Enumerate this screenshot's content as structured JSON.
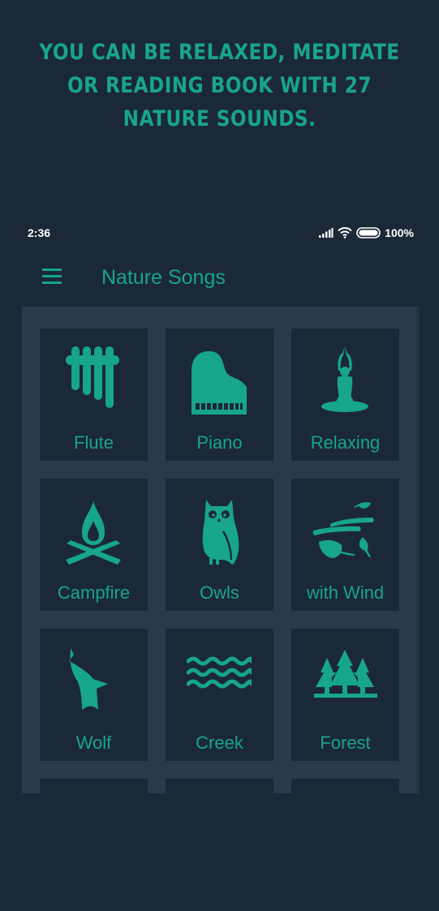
{
  "promo": {
    "lines": [
      "You can be relaxed, meditate",
      "or reading book with 27",
      "nature sounds."
    ]
  },
  "status_bar": {
    "time": "2:36",
    "battery": "100%",
    "icons": [
      "signal-icon",
      "wifi-icon",
      "battery-icon"
    ]
  },
  "app_bar": {
    "menu_icon": "hamburger-menu-icon",
    "title": "Nature Songs"
  },
  "colors": {
    "background": "#1b2838",
    "panel": "#2b3a4b",
    "tile": "#1b2838",
    "accent": "#17a58c",
    "status_text": "#ffffff"
  },
  "tiles": [
    {
      "label": "Flute",
      "icon": "pan-flute-icon"
    },
    {
      "label": "Piano",
      "icon": "grand-piano-icon"
    },
    {
      "label": "Relaxing",
      "icon": "meditation-icon"
    },
    {
      "label": "Campfire",
      "icon": "campfire-icon"
    },
    {
      "label": "Owls",
      "icon": "owl-icon"
    },
    {
      "label": "with Wind",
      "icon": "wind-leaves-icon"
    },
    {
      "label": "Wolf",
      "icon": "howling-wolf-icon"
    },
    {
      "label": "Creek",
      "icon": "water-waves-icon"
    },
    {
      "label": "Forest",
      "icon": "pine-trees-icon"
    }
  ]
}
